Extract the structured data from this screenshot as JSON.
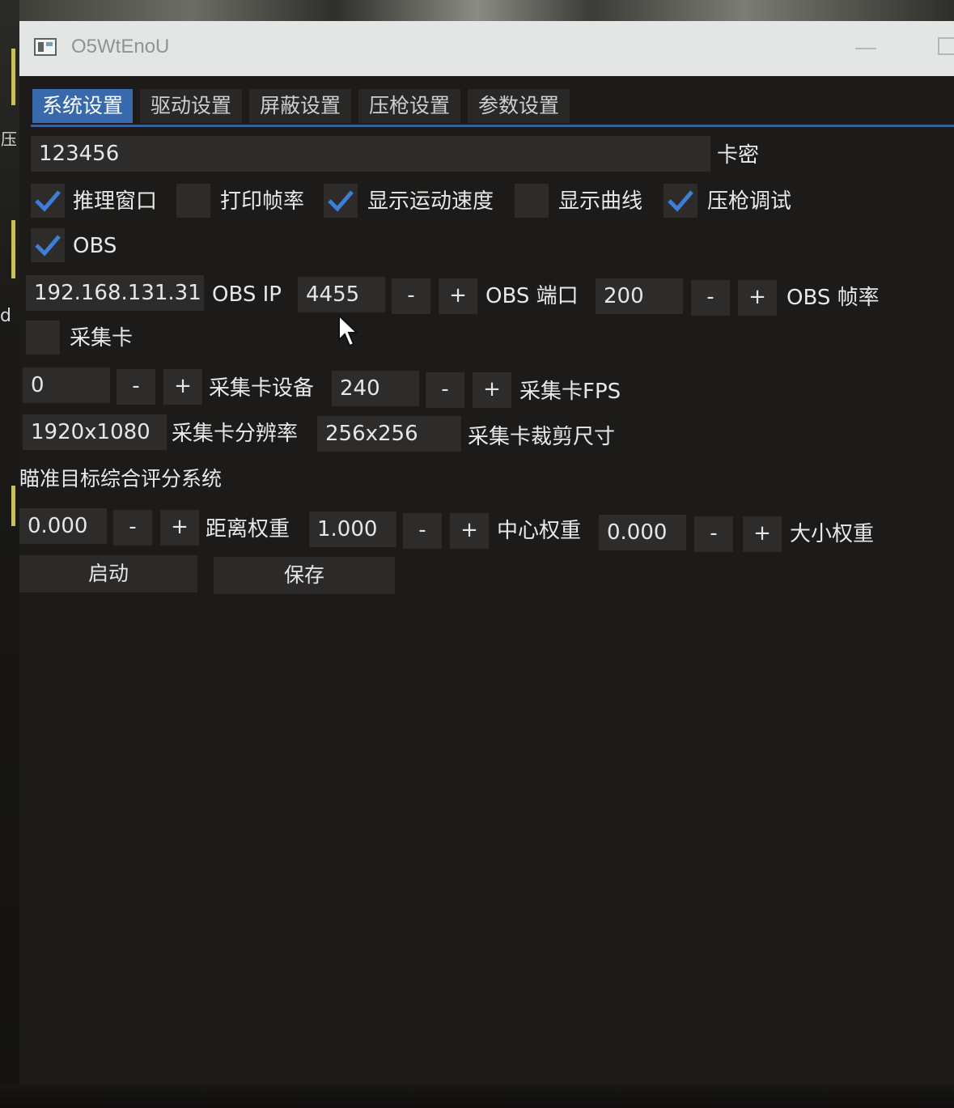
{
  "window": {
    "title": "O5WtEnoU"
  },
  "background": {
    "left_char": "压",
    "left_char2": "d"
  },
  "tabs": [
    {
      "label": "系统设置",
      "active": true
    },
    {
      "label": "驱动设置",
      "active": false
    },
    {
      "label": "屏蔽设置",
      "active": false
    },
    {
      "label": "压枪设置",
      "active": false
    },
    {
      "label": "参数设置",
      "active": false
    }
  ],
  "card_key": {
    "value": "123456",
    "label": "卡密"
  },
  "checkboxes": {
    "inference_window": {
      "label": "推理窗口",
      "checked": true
    },
    "print_fps": {
      "label": "打印帧率",
      "checked": false
    },
    "show_speed": {
      "label": "显示运动速度",
      "checked": true
    },
    "show_curve": {
      "label": "显示曲线",
      "checked": false
    },
    "recoil_debug": {
      "label": "压枪调试",
      "checked": true
    },
    "obs": {
      "label": "OBS",
      "checked": true
    },
    "capture_card": {
      "label": "采集卡",
      "checked": false
    }
  },
  "obs": {
    "ip_value": "192.168.131.31",
    "ip_label": "OBS IP",
    "port_value": "4455",
    "port_label": "OBS 端口",
    "fps_value": "200",
    "fps_label": "OBS 帧率"
  },
  "capture": {
    "device_value": "0",
    "device_label": "采集卡设备",
    "fps_value": "240",
    "fps_label": "采集卡FPS",
    "resolution_value": "1920x1080",
    "resolution_label": "采集卡分辨率",
    "crop_value": "256x256",
    "crop_label": "采集卡裁剪尺寸"
  },
  "scoring": {
    "section_title": "瞄准目标综合评分系统",
    "distance_value": "0.000",
    "distance_label": "距离权重",
    "center_value": "1.000",
    "center_label": "中心权重",
    "size_value": "0.000",
    "size_label": "大小权重"
  },
  "stepper": {
    "minus": "-",
    "plus": "+"
  },
  "actions": {
    "start_label": "启动",
    "save_label": "保存"
  },
  "colors": {
    "accent": "#3869ad",
    "check": "#3d7fd6",
    "window_bg": "#1d1b19",
    "field_bg": "#2e2c2a",
    "titlebar_bg": "#e4e6e6"
  }
}
